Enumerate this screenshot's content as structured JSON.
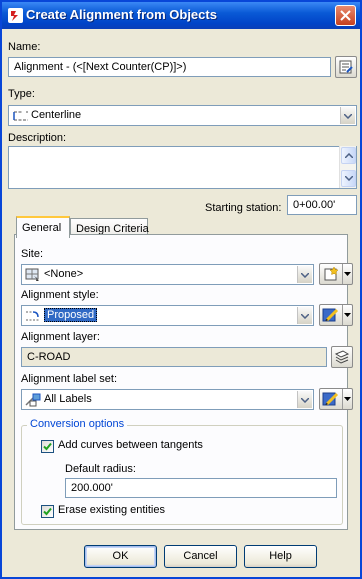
{
  "window": {
    "title": "Create Alignment from Objects"
  },
  "name": {
    "label": "Name:",
    "value": "Alignment - (<[Next Counter(CP)]>)"
  },
  "type": {
    "label": "Type:",
    "value": "Centerline"
  },
  "description": {
    "label": "Description:",
    "value": ""
  },
  "starting_station": {
    "label": "Starting station:",
    "value": "0+00.00'"
  },
  "tabs": [
    {
      "label": "General"
    },
    {
      "label": "Design Criteria"
    }
  ],
  "general": {
    "site": {
      "label": "Site:",
      "value": "<None>"
    },
    "alignment_style": {
      "label": "Alignment style:",
      "value": "Proposed"
    },
    "alignment_layer": {
      "label": "Alignment layer:",
      "value": "C-ROAD"
    },
    "alignment_label_set": {
      "label": "Alignment label set:",
      "value": "All Labels"
    },
    "conversion_options": {
      "title": "Conversion options",
      "add_curves": {
        "label": "Add curves between tangents",
        "checked": true
      },
      "default_radius": {
        "label": "Default radius:",
        "value": "200.000'"
      },
      "erase_entities": {
        "label": "Erase existing entities",
        "checked": true
      }
    }
  },
  "buttons": {
    "ok": "OK",
    "cancel": "Cancel",
    "help": "Help"
  },
  "colors": {
    "title_bar": "#0a5ad6",
    "dialog_bg": "#ece9d8",
    "group_title": "#0046d5",
    "close_button": "#c6401f"
  }
}
